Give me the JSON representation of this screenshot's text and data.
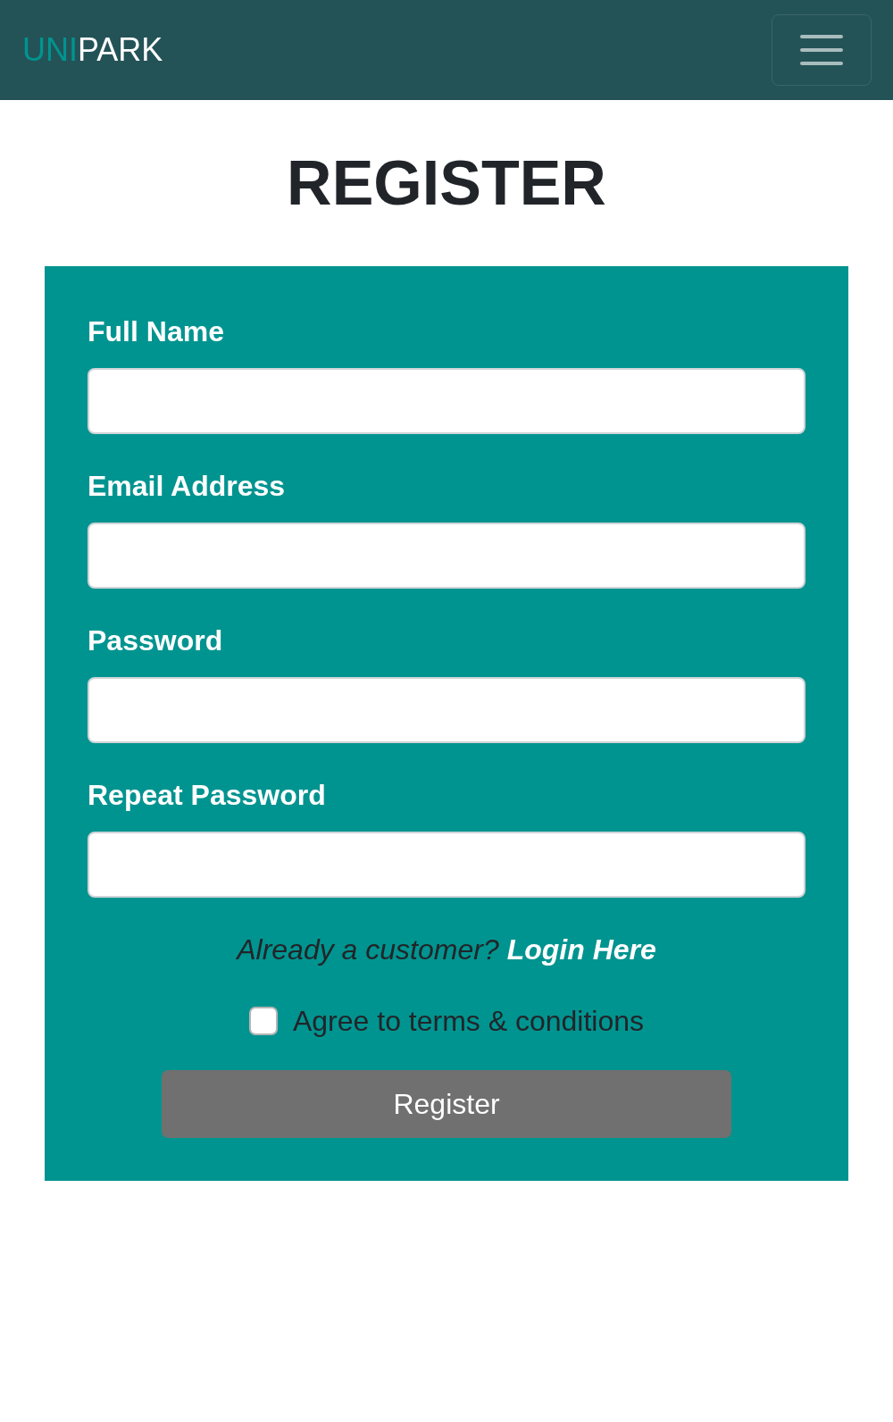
{
  "navbar": {
    "logo": {
      "accent": "UNI",
      "rest": "PARK"
    }
  },
  "title": "REGISTER",
  "form": {
    "fields": [
      {
        "label": "Full Name"
      },
      {
        "label": "Email Address"
      },
      {
        "label": "Password"
      },
      {
        "label": "Repeat Password"
      }
    ],
    "login_prompt": {
      "text": "Already a customer?",
      "link": "Login Here"
    },
    "terms": {
      "label": "Agree to terms & conditions",
      "checked": false
    },
    "submit": "Register"
  }
}
